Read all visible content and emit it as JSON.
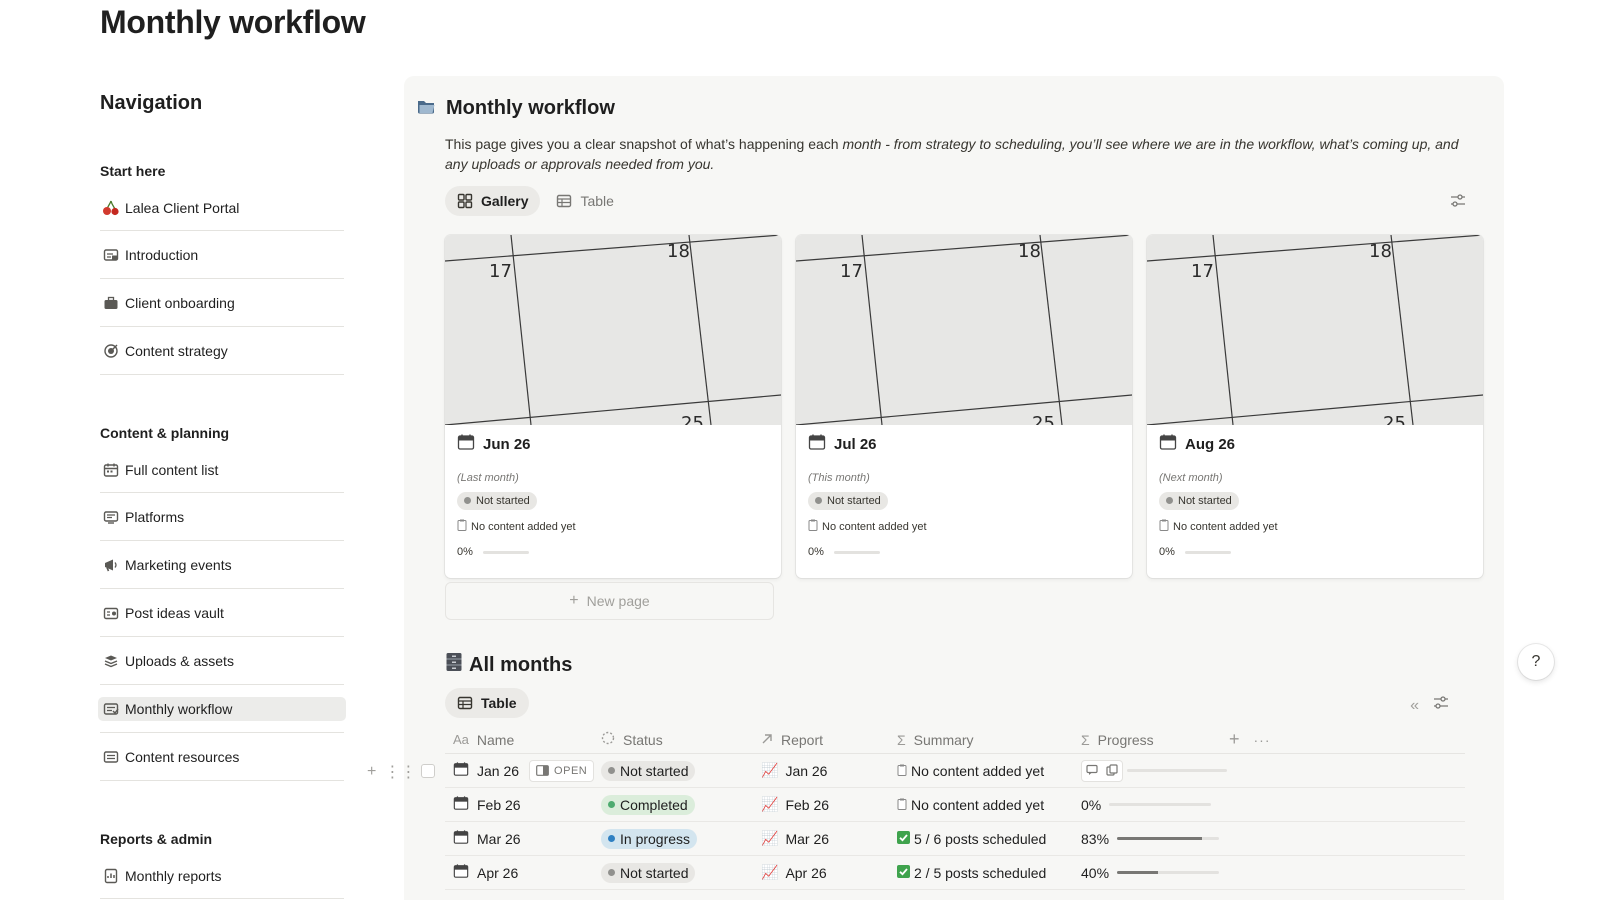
{
  "page": {
    "title": "Monthly workflow"
  },
  "navigation": {
    "heading": "Navigation",
    "sections": [
      {
        "title": "Start here",
        "items": [
          {
            "label": "Lalea Client Portal",
            "icon": "cherries-icon"
          },
          {
            "label": "Introduction",
            "icon": "page-icon"
          },
          {
            "label": "Client onboarding",
            "icon": "briefcase-icon"
          },
          {
            "label": "Content strategy",
            "icon": "target-icon"
          }
        ]
      },
      {
        "title": "Content & planning",
        "items": [
          {
            "label": "Full content list",
            "icon": "calendar-icon"
          },
          {
            "label": "Platforms",
            "icon": "screen-icon"
          },
          {
            "label": "Marketing events",
            "icon": "megaphone-icon"
          },
          {
            "label": "Post ideas vault",
            "icon": "vault-icon"
          },
          {
            "label": "Uploads & assets",
            "icon": "stack-icon"
          },
          {
            "label": "Monthly workflow",
            "icon": "workflow-icon",
            "active": true
          },
          {
            "label": "Content resources",
            "icon": "resources-icon"
          }
        ]
      },
      {
        "title": "Reports & admin",
        "items": [
          {
            "label": "Monthly reports",
            "icon": "report-icon"
          }
        ]
      }
    ]
  },
  "main": {
    "title": "Monthly workflow",
    "title_icon": "folder-icon",
    "description_plain": "This page gives you a clear snapshot of what’s happening each ",
    "description_italic": "month - from strategy to scheduling, you’ll see where we are in the workflow, what’s coming up, and any uploads or approvals needed from you.",
    "tabs": [
      {
        "label": "Gallery",
        "icon": "gallery-icon",
        "active": true
      },
      {
        "label": "Table",
        "icon": "table-icon",
        "active": false
      }
    ],
    "gallery": {
      "cover_numbers": [
        "17",
        "18",
        "25"
      ],
      "cards": [
        {
          "title": "Jun 26",
          "subtitle": "(Last month)",
          "status": "Not started",
          "summary": "No content added yet",
          "progress_text": "0%",
          "progress": 0
        },
        {
          "title": "Jul 26",
          "subtitle": "(This month)",
          "status": "Not started",
          "summary": "No content added yet",
          "progress_text": "0%",
          "progress": 0
        },
        {
          "title": "Aug 26",
          "subtitle": "(Next month)",
          "status": "Not started",
          "summary": "No content added yet",
          "progress_text": "0%",
          "progress": 0
        }
      ],
      "new_page_label": "New page"
    },
    "all_months": {
      "title": "All months",
      "title_icon": "cabinet-icon",
      "tab_label": "Table",
      "open_label": "OPEN",
      "columns": [
        {
          "label": "Name",
          "icon": "text-prop-icon"
        },
        {
          "label": "Status",
          "icon": "status-prop-icon"
        },
        {
          "label": "Report",
          "icon": "relation-prop-icon"
        },
        {
          "label": "Summary",
          "icon": "sigma-icon"
        },
        {
          "label": "Progress",
          "icon": "sigma-icon"
        }
      ],
      "rows": [
        {
          "name": "Jan 26",
          "status": "Not started",
          "report": "Jan 26",
          "summary": "No content added yet",
          "summary_icon": "clipboard",
          "progress_text": "",
          "progress": 0
        },
        {
          "name": "Feb 26",
          "status": "Completed",
          "report": "Feb 26",
          "summary": "No content added yet",
          "summary_icon": "clipboard",
          "progress_text": "0%",
          "progress": 0
        },
        {
          "name": "Mar 26",
          "status": "In progress",
          "report": "Mar 26",
          "summary": "5 / 6 posts scheduled",
          "summary_icon": "check",
          "progress_text": "83%",
          "progress": 0.83
        },
        {
          "name": "Apr 26",
          "status": "Not started",
          "report": "Apr 26",
          "summary": "2 / 5 posts scheduled",
          "summary_icon": "check",
          "progress_text": "40%",
          "progress": 0.4
        }
      ]
    }
  },
  "colors": {
    "status_not_started_bg": "#e8e7e4",
    "status_not_started_dot": "#91918e",
    "status_completed_bg": "#dbeddb",
    "status_completed_dot": "#4dab6f",
    "status_in_progress_bg": "#d3e5ef",
    "status_in_progress_dot": "#2f80c2",
    "panel_bg": "#f7f7f5"
  },
  "help_label": "?"
}
